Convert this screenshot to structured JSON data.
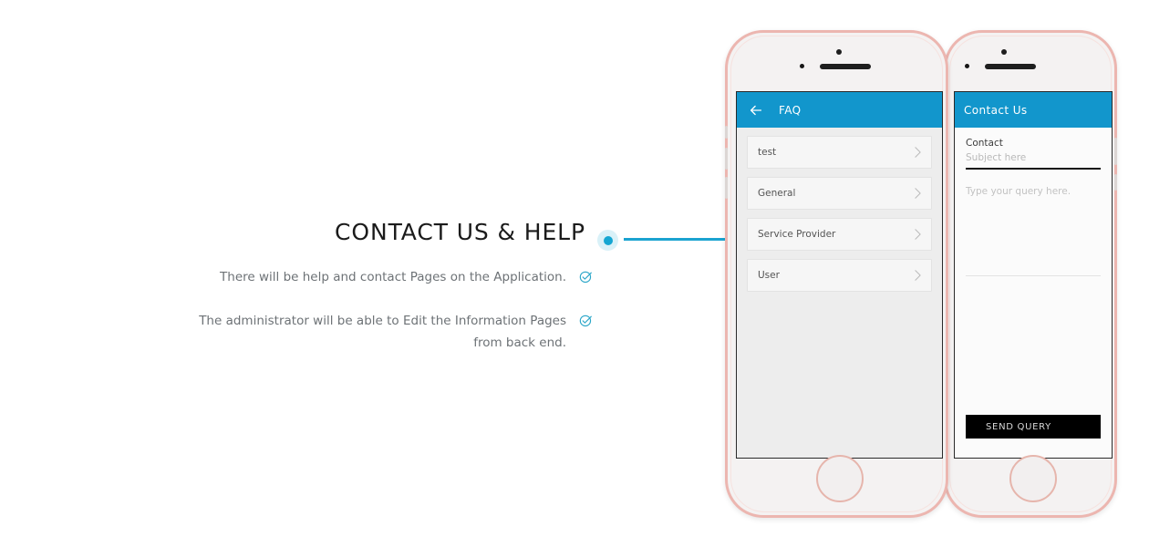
{
  "annotation": {
    "title": "CONTACT US & HELP",
    "bullets": [
      {
        "text": "There will be help and contact Pages on the Application.",
        "icon": "check-circle-icon"
      },
      {
        "text": "The administrator will be able to Edit the Information Pages from back end.",
        "icon": "check-circle-icon"
      }
    ]
  },
  "connector": {
    "dot_color": "#14a6d2",
    "halo_color": "#d9f1f8",
    "line_color": "#1ba3d0"
  },
  "phones": {
    "front": {
      "device": "rose-gold-smartphone",
      "frame_color": "#ecb6b0",
      "body_color": "#f4f2f2",
      "screen": {
        "appbar": {
          "back_icon": "arrow-left-icon",
          "title": "FAQ",
          "background": "#1296cc",
          "text_color": "#ffffff"
        },
        "faq_items": [
          {
            "label": "test",
            "chevron": "chevron-right-icon"
          },
          {
            "label": "General",
            "chevron": "chevron-right-icon"
          },
          {
            "label": "Service Provider",
            "chevron": "chevron-right-icon"
          },
          {
            "label": "User",
            "chevron": "chevron-right-icon"
          }
        ]
      }
    },
    "back": {
      "device": "rose-gold-smartphone",
      "frame_color": "#ecb6b0",
      "body_color": "#f4f2f2",
      "screen": {
        "appbar": {
          "title": "Contact Us",
          "background": "#1296cc",
          "text_color": "#ffffff"
        },
        "subject_label": "Contact",
        "subject_placeholder": "Subject here",
        "message_placeholder": "Type your query here.",
        "send_button": "SEND QUERY",
        "send_button_bg": "#000000",
        "send_button_text_color": "#d8d8d8"
      }
    }
  }
}
